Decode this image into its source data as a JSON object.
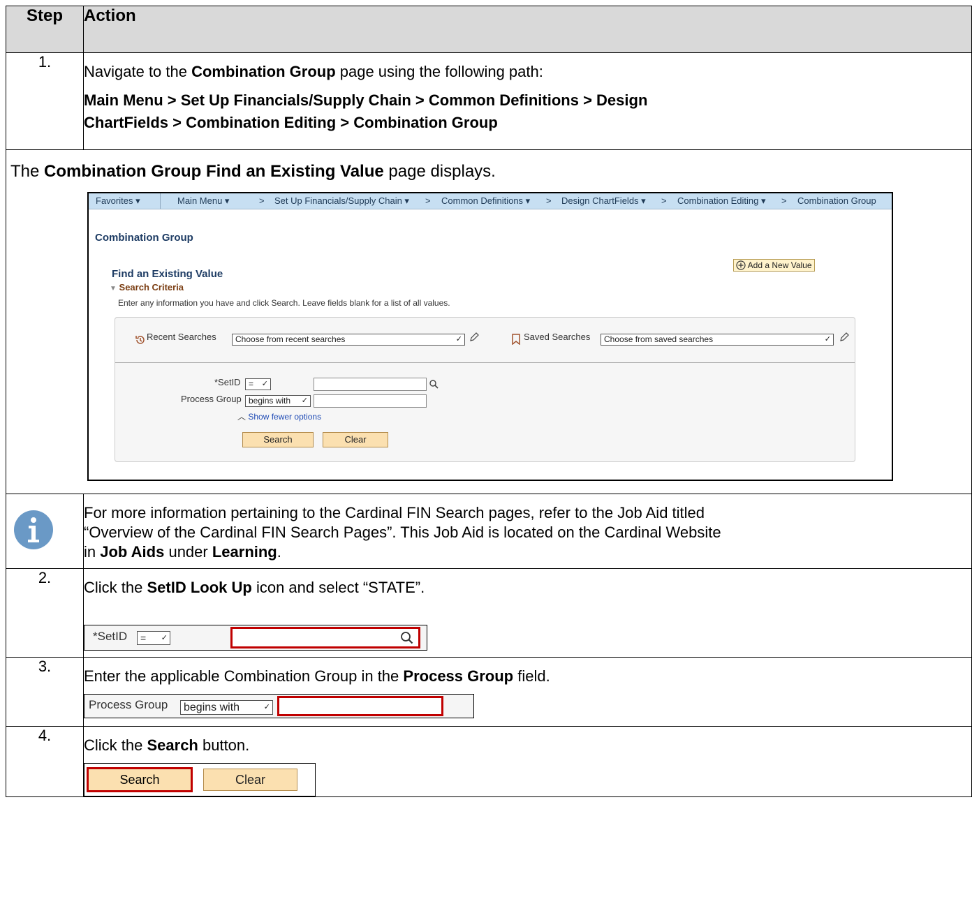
{
  "header": {
    "step": "Step",
    "action": "Action"
  },
  "step1": {
    "num": "1.",
    "line1_a": "Navigate to the ",
    "line1_b": "Combination Group",
    "line1_c": " page using the following path:",
    "path_line1": "Main Menu > Set Up Financials/Supply Chain > Common Definitions > Design",
    "path_line2": "ChartFields > Combination Editing > Combination Group"
  },
  "displays": {
    "a": "The ",
    "b": "Combination Group Find an Existing Value",
    "c": " page displays."
  },
  "shot": {
    "nav": {
      "favorites": "Favorites ▾",
      "main_menu": "Main Menu ▾",
      "sep1": ">",
      "setup": "Set Up Financials/Supply Chain ▾",
      "sep2": ">",
      "common": "Common Definitions ▾",
      "sep3": ">",
      "design": "Design ChartFields ▾",
      "sep4": ">",
      "editing": "Combination Editing ▾",
      "sep5": ">",
      "group": "Combination Group"
    },
    "page_title": "Combination Group",
    "add_new": "Add a New Value",
    "find_heading": "Find an Existing Value",
    "criteria": "Search Criteria",
    "instructions": "Enter any information you have and click Search. Leave fields blank for a list of all values.",
    "recent_label": "Recent Searches",
    "recent_value": "Choose from recent searches",
    "saved_label": "Saved Searches",
    "saved_value": "Choose from saved searches",
    "setid_label": "*SetID",
    "setid_op": "=",
    "pg_label": "Process Group",
    "pg_op": "begins with",
    "fewer": "Show fewer options",
    "search_btn": "Search",
    "clear_btn": "Clear"
  },
  "info": {
    "line1": "For more information pertaining to the Cardinal FIN Search pages, refer to the Job Aid titled",
    "line2": "“Overview of the Cardinal FIN Search Pages”.  This Job Aid is located on the Cardinal Website",
    "line3_a": "in ",
    "line3_b": "Job Aids",
    "line3_c": " under ",
    "line3_d": "Learning",
    "line3_e": "."
  },
  "step2": {
    "num": "2.",
    "a": "Click the ",
    "b": "SetID Look Up",
    "c": " icon and select “STATE”.",
    "label": "*SetID",
    "op": "="
  },
  "step3": {
    "num": "3.",
    "a": "Enter the applicable Combination Group in the ",
    "b": "Process Group",
    "c": " field.",
    "label": "Process Group",
    "op": "begins with"
  },
  "step4": {
    "num": "4.",
    "a": "Click the ",
    "b": "Search",
    "c": " button.",
    "search": "Search",
    "clear": "Clear"
  },
  "colors": {
    "header_bg": "#d9d9d9",
    "highlight": "#c00000",
    "nav_bg": "#c7dff2",
    "button_bg": "#fbe0b0"
  }
}
